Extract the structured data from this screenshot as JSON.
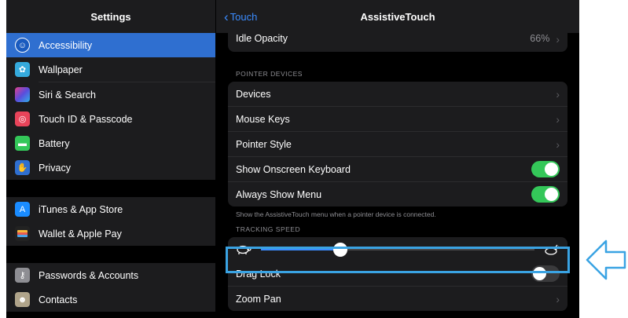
{
  "sidebar": {
    "title": "Settings",
    "groups": [
      [
        {
          "label": "Accessibility",
          "icon": "accessibility-icon",
          "color": "#2f6fd0",
          "selected": true
        },
        {
          "label": "Wallpaper",
          "icon": "wallpaper-icon",
          "color": "#35aadc"
        },
        {
          "label": "Siri & Search",
          "icon": "siri-icon",
          "color": "#222222"
        },
        {
          "label": "Touch ID & Passcode",
          "icon": "fingerprint-icon",
          "color": "#e8445a"
        },
        {
          "label": "Battery",
          "icon": "battery-icon",
          "color": "#34c759"
        },
        {
          "label": "Privacy",
          "icon": "hand-icon",
          "color": "#2f6fd0"
        }
      ],
      [
        {
          "label": "iTunes & App Store",
          "icon": "app-store-icon",
          "color": "#1a8cff"
        },
        {
          "label": "Wallet & Apple Pay",
          "icon": "wallet-icon",
          "color": "#222222"
        }
      ],
      [
        {
          "label": "Passwords & Accounts",
          "icon": "key-icon",
          "color": "#8e8e93"
        },
        {
          "label": "Contacts",
          "icon": "contacts-icon",
          "color": "#b0a48a"
        }
      ]
    ]
  },
  "detail": {
    "back_label": "Touch",
    "title": "AssistiveTouch",
    "idle_opacity": {
      "label": "Idle Opacity",
      "value": "66%"
    },
    "pointer_section": "POINTER DEVICES",
    "pointer_rows": {
      "devices": "Devices",
      "mouse_keys": "Mouse Keys",
      "pointer_style": "Pointer Style",
      "show_keyboard": "Show Onscreen Keyboard",
      "always_show_menu": "Always Show Menu"
    },
    "toggles": {
      "show_keyboard": true,
      "always_show_menu": true,
      "drag_lock": false
    },
    "pointer_footer": "Show the AssistiveTouch menu when a pointer device is connected.",
    "tracking_section": "TRACKING SPEED",
    "tracking_speed": 0.29,
    "drag_lock": "Drag Lock",
    "zoom_pan": "Zoom Pan"
  },
  "colors": {
    "accent": "#3b8cff",
    "toggle_on": "#34c759",
    "highlight": "#3aa3e3"
  }
}
